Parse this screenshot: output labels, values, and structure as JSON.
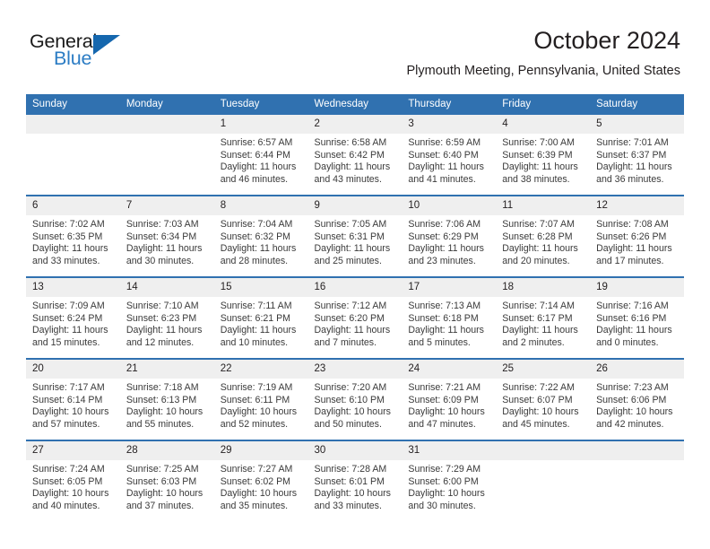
{
  "brand": {
    "word_general": "General",
    "word_blue": "Blue",
    "triangle_color": "#1567ae",
    "blue_text_color": "#2b7cc4"
  },
  "header": {
    "title": "October 2024",
    "location": "Plymouth Meeting, Pennsylvania, United States"
  },
  "theme": {
    "header_bar": "#3071b0",
    "daynum_band": "#efefef",
    "text": "#231f20",
    "body_text": "#3a3a3a"
  },
  "weekday_headers": [
    "Sunday",
    "Monday",
    "Tuesday",
    "Wednesday",
    "Thursday",
    "Friday",
    "Saturday"
  ],
  "labels": {
    "sunrise_prefix": "Sunrise:",
    "sunset_prefix": "Sunset:",
    "daylight_prefix": "Daylight:"
  },
  "weeks": [
    [
      {
        "day": "",
        "sunrise": "",
        "sunset": "",
        "daylight_1": "",
        "daylight_2": ""
      },
      {
        "day": "",
        "sunrise": "",
        "sunset": "",
        "daylight_1": "",
        "daylight_2": ""
      },
      {
        "day": "1",
        "sunrise": "Sunrise: 6:57 AM",
        "sunset": "Sunset: 6:44 PM",
        "daylight_1": "Daylight: 11 hours",
        "daylight_2": "and 46 minutes."
      },
      {
        "day": "2",
        "sunrise": "Sunrise: 6:58 AM",
        "sunset": "Sunset: 6:42 PM",
        "daylight_1": "Daylight: 11 hours",
        "daylight_2": "and 43 minutes."
      },
      {
        "day": "3",
        "sunrise": "Sunrise: 6:59 AM",
        "sunset": "Sunset: 6:40 PM",
        "daylight_1": "Daylight: 11 hours",
        "daylight_2": "and 41 minutes."
      },
      {
        "day": "4",
        "sunrise": "Sunrise: 7:00 AM",
        "sunset": "Sunset: 6:39 PM",
        "daylight_1": "Daylight: 11 hours",
        "daylight_2": "and 38 minutes."
      },
      {
        "day": "5",
        "sunrise": "Sunrise: 7:01 AM",
        "sunset": "Sunset: 6:37 PM",
        "daylight_1": "Daylight: 11 hours",
        "daylight_2": "and 36 minutes."
      }
    ],
    [
      {
        "day": "6",
        "sunrise": "Sunrise: 7:02 AM",
        "sunset": "Sunset: 6:35 PM",
        "daylight_1": "Daylight: 11 hours",
        "daylight_2": "and 33 minutes."
      },
      {
        "day": "7",
        "sunrise": "Sunrise: 7:03 AM",
        "sunset": "Sunset: 6:34 PM",
        "daylight_1": "Daylight: 11 hours",
        "daylight_2": "and 30 minutes."
      },
      {
        "day": "8",
        "sunrise": "Sunrise: 7:04 AM",
        "sunset": "Sunset: 6:32 PM",
        "daylight_1": "Daylight: 11 hours",
        "daylight_2": "and 28 minutes."
      },
      {
        "day": "9",
        "sunrise": "Sunrise: 7:05 AM",
        "sunset": "Sunset: 6:31 PM",
        "daylight_1": "Daylight: 11 hours",
        "daylight_2": "and 25 minutes."
      },
      {
        "day": "10",
        "sunrise": "Sunrise: 7:06 AM",
        "sunset": "Sunset: 6:29 PM",
        "daylight_1": "Daylight: 11 hours",
        "daylight_2": "and 23 minutes."
      },
      {
        "day": "11",
        "sunrise": "Sunrise: 7:07 AM",
        "sunset": "Sunset: 6:28 PM",
        "daylight_1": "Daylight: 11 hours",
        "daylight_2": "and 20 minutes."
      },
      {
        "day": "12",
        "sunrise": "Sunrise: 7:08 AM",
        "sunset": "Sunset: 6:26 PM",
        "daylight_1": "Daylight: 11 hours",
        "daylight_2": "and 17 minutes."
      }
    ],
    [
      {
        "day": "13",
        "sunrise": "Sunrise: 7:09 AM",
        "sunset": "Sunset: 6:24 PM",
        "daylight_1": "Daylight: 11 hours",
        "daylight_2": "and 15 minutes."
      },
      {
        "day": "14",
        "sunrise": "Sunrise: 7:10 AM",
        "sunset": "Sunset: 6:23 PM",
        "daylight_1": "Daylight: 11 hours",
        "daylight_2": "and 12 minutes."
      },
      {
        "day": "15",
        "sunrise": "Sunrise: 7:11 AM",
        "sunset": "Sunset: 6:21 PM",
        "daylight_1": "Daylight: 11 hours",
        "daylight_2": "and 10 minutes."
      },
      {
        "day": "16",
        "sunrise": "Sunrise: 7:12 AM",
        "sunset": "Sunset: 6:20 PM",
        "daylight_1": "Daylight: 11 hours",
        "daylight_2": "and 7 minutes."
      },
      {
        "day": "17",
        "sunrise": "Sunrise: 7:13 AM",
        "sunset": "Sunset: 6:18 PM",
        "daylight_1": "Daylight: 11 hours",
        "daylight_2": "and 5 minutes."
      },
      {
        "day": "18",
        "sunrise": "Sunrise: 7:14 AM",
        "sunset": "Sunset: 6:17 PM",
        "daylight_1": "Daylight: 11 hours",
        "daylight_2": "and 2 minutes."
      },
      {
        "day": "19",
        "sunrise": "Sunrise: 7:16 AM",
        "sunset": "Sunset: 6:16 PM",
        "daylight_1": "Daylight: 11 hours",
        "daylight_2": "and 0 minutes."
      }
    ],
    [
      {
        "day": "20",
        "sunrise": "Sunrise: 7:17 AM",
        "sunset": "Sunset: 6:14 PM",
        "daylight_1": "Daylight: 10 hours",
        "daylight_2": "and 57 minutes."
      },
      {
        "day": "21",
        "sunrise": "Sunrise: 7:18 AM",
        "sunset": "Sunset: 6:13 PM",
        "daylight_1": "Daylight: 10 hours",
        "daylight_2": "and 55 minutes."
      },
      {
        "day": "22",
        "sunrise": "Sunrise: 7:19 AM",
        "sunset": "Sunset: 6:11 PM",
        "daylight_1": "Daylight: 10 hours",
        "daylight_2": "and 52 minutes."
      },
      {
        "day": "23",
        "sunrise": "Sunrise: 7:20 AM",
        "sunset": "Sunset: 6:10 PM",
        "daylight_1": "Daylight: 10 hours",
        "daylight_2": "and 50 minutes."
      },
      {
        "day": "24",
        "sunrise": "Sunrise: 7:21 AM",
        "sunset": "Sunset: 6:09 PM",
        "daylight_1": "Daylight: 10 hours",
        "daylight_2": "and 47 minutes."
      },
      {
        "day": "25",
        "sunrise": "Sunrise: 7:22 AM",
        "sunset": "Sunset: 6:07 PM",
        "daylight_1": "Daylight: 10 hours",
        "daylight_2": "and 45 minutes."
      },
      {
        "day": "26",
        "sunrise": "Sunrise: 7:23 AM",
        "sunset": "Sunset: 6:06 PM",
        "daylight_1": "Daylight: 10 hours",
        "daylight_2": "and 42 minutes."
      }
    ],
    [
      {
        "day": "27",
        "sunrise": "Sunrise: 7:24 AM",
        "sunset": "Sunset: 6:05 PM",
        "daylight_1": "Daylight: 10 hours",
        "daylight_2": "and 40 minutes."
      },
      {
        "day": "28",
        "sunrise": "Sunrise: 7:25 AM",
        "sunset": "Sunset: 6:03 PM",
        "daylight_1": "Daylight: 10 hours",
        "daylight_2": "and 37 minutes."
      },
      {
        "day": "29",
        "sunrise": "Sunrise: 7:27 AM",
        "sunset": "Sunset: 6:02 PM",
        "daylight_1": "Daylight: 10 hours",
        "daylight_2": "and 35 minutes."
      },
      {
        "day": "30",
        "sunrise": "Sunrise: 7:28 AM",
        "sunset": "Sunset: 6:01 PM",
        "daylight_1": "Daylight: 10 hours",
        "daylight_2": "and 33 minutes."
      },
      {
        "day": "31",
        "sunrise": "Sunrise: 7:29 AM",
        "sunset": "Sunset: 6:00 PM",
        "daylight_1": "Daylight: 10 hours",
        "daylight_2": "and 30 minutes."
      },
      {
        "day": "",
        "sunrise": "",
        "sunset": "",
        "daylight_1": "",
        "daylight_2": ""
      },
      {
        "day": "",
        "sunrise": "",
        "sunset": "",
        "daylight_1": "",
        "daylight_2": ""
      }
    ]
  ]
}
